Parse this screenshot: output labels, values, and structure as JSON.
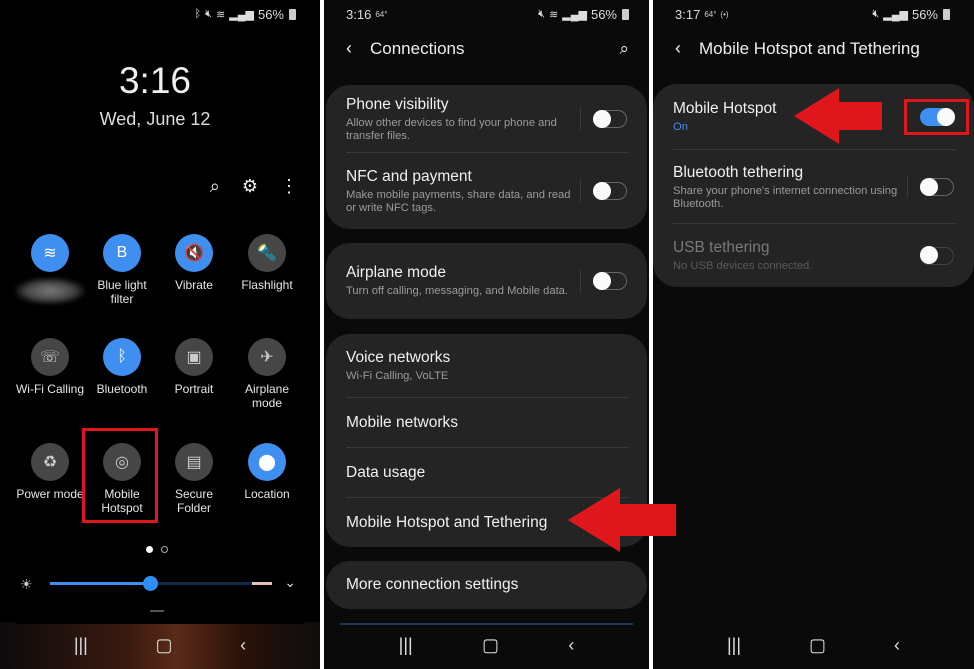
{
  "screens": {
    "quick_panel": {
      "status": {
        "icons": [
          "bluetooth-icon",
          "mute-vibrate-icon",
          "wifi-icon",
          "signal-icon"
        ],
        "battery": "56%"
      },
      "clock": "3:16",
      "date": "Wed, June 12",
      "top_actions": {
        "search": "⌕",
        "settings": "⚙",
        "more": "⋮"
      },
      "tiles": [
        {
          "label": "",
          "icon": "wifi-icon",
          "glyph": "≋",
          "on": true,
          "blurred": true
        },
        {
          "label": "Blue light filter",
          "icon": "blue-light-filter-icon",
          "glyph": "B",
          "on": true
        },
        {
          "label": "Vibrate",
          "icon": "vibrate-icon",
          "glyph": "🔇",
          "on": true
        },
        {
          "label": "Flashlight",
          "icon": "flashlight-icon",
          "glyph": "🔦",
          "on": false
        },
        {
          "label": "Wi-Fi Calling",
          "icon": "wifi-calling-icon",
          "glyph": "☏",
          "on": false
        },
        {
          "label": "Bluetooth",
          "icon": "bluetooth-icon",
          "glyph": "ᛒ",
          "on": true
        },
        {
          "label": "Portrait",
          "icon": "portrait-lock-icon",
          "glyph": "▣",
          "on": false
        },
        {
          "label": "Airplane mode",
          "icon": "airplane-icon",
          "glyph": "✈",
          "on": false
        },
        {
          "label": "Power mode",
          "icon": "power-mode-icon",
          "glyph": "♻",
          "on": false
        },
        {
          "label": "Mobile Hotspot",
          "icon": "mobile-hotspot-icon",
          "glyph": "◎",
          "on": false
        },
        {
          "label": "Secure Folder",
          "icon": "secure-folder-icon",
          "glyph": "▤",
          "on": false
        },
        {
          "label": "Location",
          "icon": "location-icon",
          "glyph": "⬤",
          "on": true
        }
      ],
      "page_indicator": {
        "pages": 2,
        "current": 1
      },
      "brightness": {
        "level": 0.45
      },
      "nav": {
        "recents": "|||",
        "home": "▢",
        "back": "‹"
      }
    },
    "connections": {
      "status": {
        "time": "3:16",
        "temp": "64°",
        "battery": "56%"
      },
      "title": "Connections",
      "groups": [
        [
          {
            "title": "Phone visibility",
            "subtitle": "Allow other devices to find your phone and transfer files.",
            "toggle": false
          },
          {
            "title": "NFC and payment",
            "subtitle": "Make mobile payments, share data, and read or write NFC tags.",
            "toggle": false
          }
        ],
        [
          {
            "title": "Airplane mode",
            "subtitle": "Turn off calling, messaging, and Mobile data.",
            "toggle": false
          }
        ],
        [
          {
            "title": "Voice networks",
            "subtitle": "Wi-Fi Calling, VoLTE"
          },
          {
            "title": "Mobile networks"
          },
          {
            "title": "Data usage"
          },
          {
            "title": "Mobile Hotspot and Tethering"
          }
        ],
        [
          {
            "title": "More connection settings"
          }
        ]
      ]
    },
    "hotspot": {
      "status": {
        "time": "3:17",
        "temp": "64°",
        "hotspot": "(•)",
        "battery": "56%"
      },
      "title": "Mobile Hotspot and Tethering",
      "rows": [
        {
          "title": "Mobile Hotspot",
          "subtitle": "On",
          "toggle": true,
          "enabled": true
        },
        {
          "title": "Bluetooth tethering",
          "subtitle": "Share your phone's internet connection using Bluetooth.",
          "toggle": false,
          "enabled": true
        },
        {
          "title": "USB tethering",
          "subtitle": "No USB devices connected.",
          "toggle": false,
          "enabled": false
        }
      ]
    }
  },
  "annotation_color": "#e0161d",
  "accent_color": "#3f8ff0"
}
